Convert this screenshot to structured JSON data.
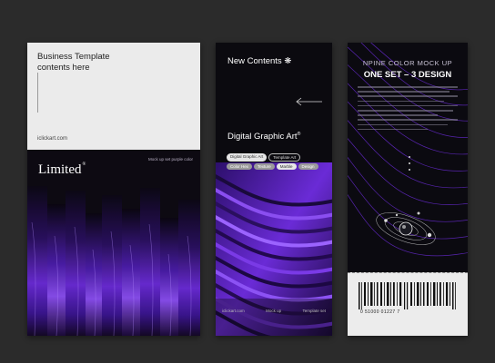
{
  "card1": {
    "title": "Business Template\ncontents here",
    "url": "iclickart.com",
    "limited": "Limited",
    "limited_mark": "®",
    "mock_text": "Mock up set purple color"
  },
  "card2": {
    "heading": "New Contents",
    "heading_symbol": "❋",
    "subtitle": "Digital Graphic Art",
    "subtitle_mark": "®",
    "tags": [
      "Digital Graphic Art",
      "Template Art",
      "Color Hex",
      "Texture",
      "Marble",
      "Design"
    ],
    "footer": [
      "iclickart.com",
      "Mock up",
      "Template set"
    ]
  },
  "card3": {
    "title": "NPINE COLOR MOCK UP",
    "subtitle": "ONE SET – 3 DESIGN",
    "barcode_digits": "0   51000   01227   7"
  },
  "colors": {
    "background": "#2b2b2b",
    "accent_purple": "#6a2bd6",
    "panel_light": "#ebebeb"
  }
}
